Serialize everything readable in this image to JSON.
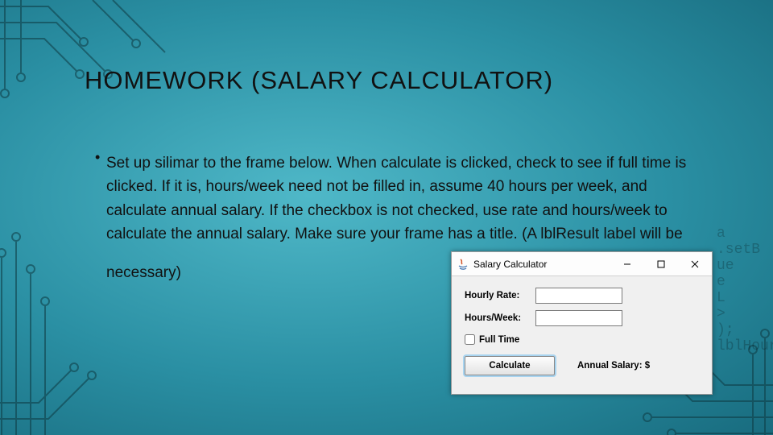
{
  "title": "HOMEWORK   (SALARY CALCULATOR)",
  "bullet": "Set up silimar to the frame below.   When calculate is clicked, check to see if full time is clicked.  If it is, hours/week need not be filled in, assume 40 hours per week, and calculate annual salary.  If the checkbox is not checked, use rate and hours/week to calculate the annual salary.  Make sure your frame has a title.  (A lblResult label will be",
  "bullet_cont": "necessary)",
  "window": {
    "title": "Salary Calculator",
    "hourly_rate_label": "Hourly Rate:",
    "hours_week_label": "Hours/Week:",
    "full_time_label": "Full Time",
    "calculate_label": "Calculate",
    "annual_label": "Annual Salary: $",
    "hourly_rate_value": "",
    "hours_week_value": "",
    "full_time_checked": false
  },
  "ghost_code": "a\n.setB\nue\ne\nL\n>\n);\nlblHours.setBo"
}
